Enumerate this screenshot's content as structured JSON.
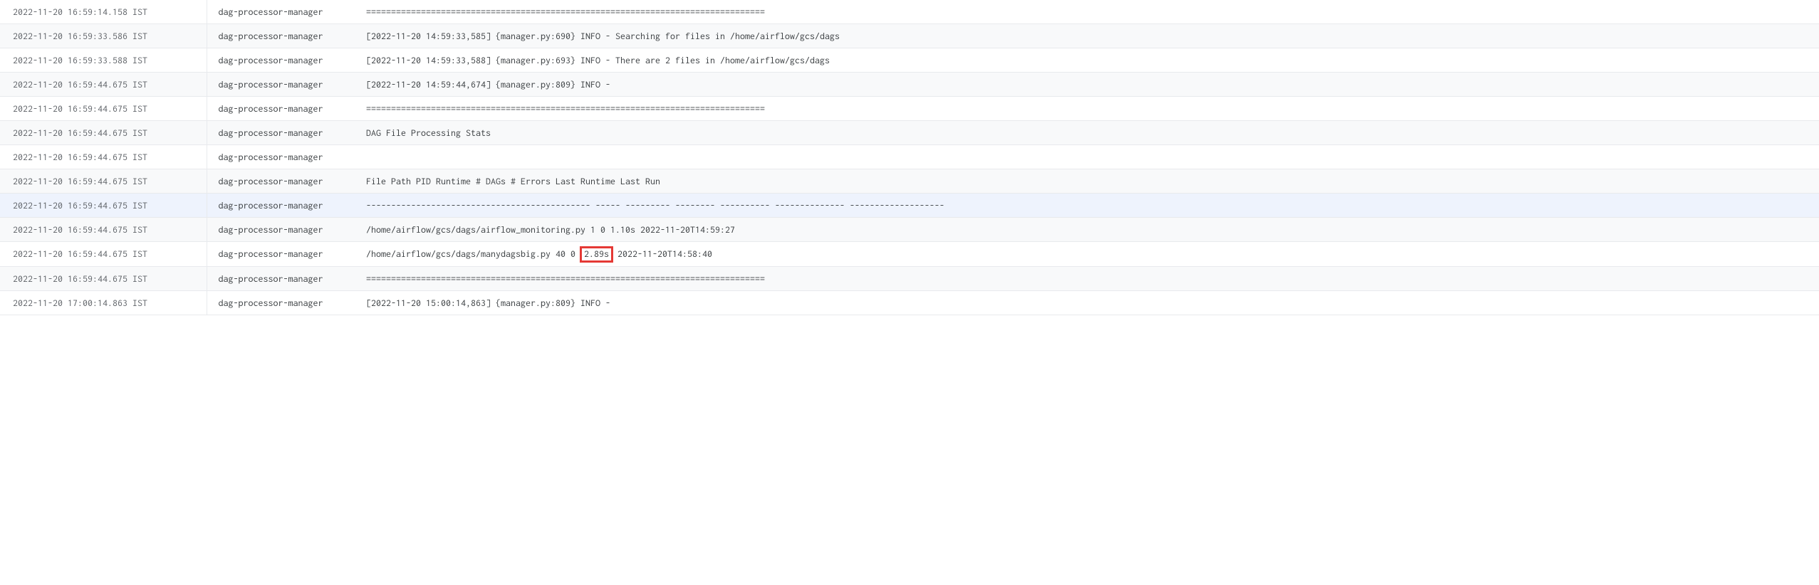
{
  "logs": [
    {
      "timestamp": "2022-11-20 16:59:14.158 IST",
      "source": "dag-processor-manager",
      "message": "================================================================================"
    },
    {
      "timestamp": "2022-11-20 16:59:33.586 IST",
      "source": "dag-processor-manager",
      "message": "[2022-11-20 14:59:33,585] {manager.py:690} INFO - Searching for files in /home/airflow/gcs/dags"
    },
    {
      "timestamp": "2022-11-20 16:59:33.588 IST",
      "source": "dag-processor-manager",
      "message": "[2022-11-20 14:59:33,588] {manager.py:693} INFO - There are 2 files in /home/airflow/gcs/dags"
    },
    {
      "timestamp": "2022-11-20 16:59:44.675 IST",
      "source": "dag-processor-manager",
      "message": "[2022-11-20 14:59:44,674] {manager.py:809} INFO - "
    },
    {
      "timestamp": "2022-11-20 16:59:44.675 IST",
      "source": "dag-processor-manager",
      "message": "================================================================================"
    },
    {
      "timestamp": "2022-11-20 16:59:44.675 IST",
      "source": "dag-processor-manager",
      "message": "DAG File Processing Stats"
    },
    {
      "timestamp": "2022-11-20 16:59:44.675 IST",
      "source": "dag-processor-manager",
      "message": ""
    },
    {
      "timestamp": "2022-11-20 16:59:44.675 IST",
      "source": "dag-processor-manager",
      "message": "File Path PID Runtime # DAGs # Errors Last Runtime Last Run"
    },
    {
      "timestamp": "2022-11-20 16:59:44.675 IST",
      "source": "dag-processor-manager",
      "message": "--------------------------------------------- ----- --------- -------- ---------- -------------- -------------------",
      "hovered": true
    },
    {
      "timestamp": "2022-11-20 16:59:44.675 IST",
      "source": "dag-processor-manager",
      "message": "/home/airflow/gcs/dags/airflow_monitoring.py 1 0 1.10s 2022-11-20T14:59:27"
    },
    {
      "timestamp": "2022-11-20 16:59:44.675 IST",
      "source": "dag-processor-manager",
      "message_pre": "/home/airflow/gcs/dags/manydagsbig.py 40 0 ",
      "highlight": "2.89s",
      "message_post": " 2022-11-20T14:58:40"
    },
    {
      "timestamp": "2022-11-20 16:59:44.675 IST",
      "source": "dag-processor-manager",
      "message": "================================================================================"
    },
    {
      "timestamp": "2022-11-20 17:00:14.863 IST",
      "source": "dag-processor-manager",
      "message": "[2022-11-20 15:00:14,863] {manager.py:809} INFO - "
    }
  ]
}
